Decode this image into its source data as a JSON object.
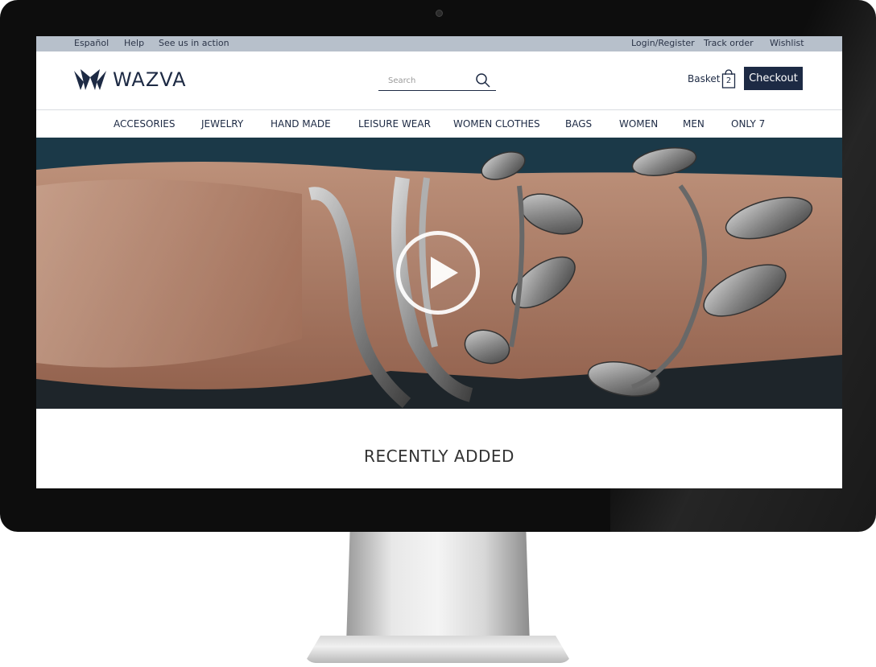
{
  "utility_bar": {
    "language": "Español",
    "help": "Help",
    "see_us": "See us in action",
    "login": "Login/Register",
    "track_order": "Track order",
    "wishlist": "Wishlist"
  },
  "header": {
    "logo_text": "WAZVA",
    "search_placeholder": "Search",
    "basket_label": "Basket",
    "basket_count": "2",
    "checkout_label": "Checkout"
  },
  "nav": {
    "items": [
      "ACCESORIES",
      "JEWELRY",
      "HAND MADE",
      "LEISURE WEAR",
      "WOMEN CLOTHES",
      "BAGS",
      "WOMEN",
      "MEN",
      "ONLY 7"
    ]
  },
  "main": {
    "section_title": "RECENTLY ADDED"
  },
  "colors": {
    "brand": "#1d2a44",
    "utility_bar": "#b7c0cb"
  },
  "icons": {
    "search": "search-icon",
    "basket": "basket-icon",
    "play": "play-icon",
    "logo": "logo-icon"
  }
}
